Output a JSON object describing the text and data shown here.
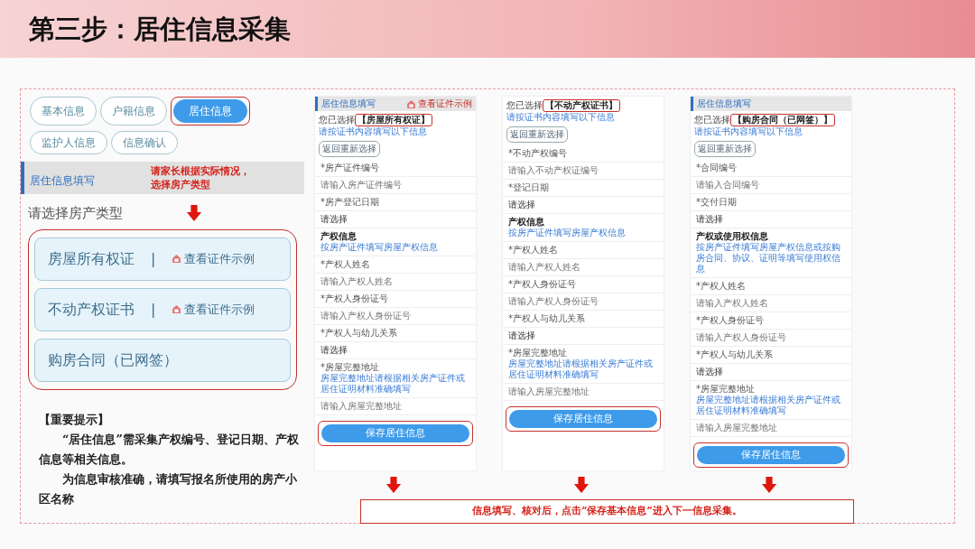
{
  "slide": {
    "title": "第三步：居住信息采集"
  },
  "left_panel": {
    "tabs": [
      {
        "label": "基本信息",
        "selected": false,
        "highlighted": false
      },
      {
        "label": "户籍信息",
        "selected": false,
        "highlighted": false
      },
      {
        "label": "居住信息",
        "selected": true,
        "highlighted": true
      },
      {
        "label": "监护人信息",
        "selected": false,
        "highlighted": false
      },
      {
        "label": "信息确认",
        "selected": false,
        "highlighted": false
      }
    ],
    "annotation": [
      "请家长根据实际情况，",
      "选择房产类型"
    ],
    "section_title": "居住信息填写",
    "prompt": "请选择房产类型",
    "options_highlighted": true,
    "options": [
      {
        "label": "房屋所有权证",
        "separator": "|",
        "link": "查看证件示例"
      },
      {
        "label": "不动产权证书",
        "separator": "|",
        "link": "查看证件示例"
      },
      {
        "label": "购房合同（已网签）"
      }
    ]
  },
  "phones": [
    {
      "header": "居住信息填写",
      "header_link": "查看证件示例",
      "selected_prefix": "您已选择",
      "selected_type": "【房屋所有权证】",
      "selected_highlighted": true,
      "hint": "请按证书内容填写以下信息",
      "back_button": "返回重新选择",
      "rows": [
        {
          "kind": "input",
          "label": "*房产证件编号",
          "placeholder": "请输入房产证件编号"
        },
        {
          "kind": "select",
          "label": "*房产登记日期",
          "value": "请选择"
        },
        {
          "kind": "section",
          "title": "产权信息",
          "note": "按房产证件填写房屋产权信息"
        },
        {
          "kind": "input",
          "label": "*产权人姓名",
          "placeholder": "请输入产权人姓名"
        },
        {
          "kind": "input",
          "label": "*产权人身份证号",
          "placeholder": "请输入产权人身份证号"
        },
        {
          "kind": "select",
          "label": "*产权人与幼儿关系",
          "value": "请选择"
        },
        {
          "kind": "input",
          "label": "*房屋完整地址",
          "note": "房屋完整地址请根据相关房产证件或居住证明材料准确填写",
          "placeholder": "请输入房屋完整地址"
        }
      ],
      "save_button": "保存居住信息",
      "save_highlighted": true
    },
    {
      "selected_prefix": "您已选择",
      "selected_type": "【不动产权证书】",
      "selected_highlighted": true,
      "hint": "请按证书内容填写以下信息",
      "back_button": "返回重新选择",
      "rows": [
        {
          "kind": "input",
          "label": "*不动产权编号",
          "placeholder": "请输入不动产权证编号"
        },
        {
          "kind": "select",
          "label": "*登记日期",
          "value": "请选择"
        },
        {
          "kind": "section",
          "title": "产权信息",
          "note": "按房产证件填写房屋产权信息"
        },
        {
          "kind": "input",
          "label": "*产权人姓名",
          "placeholder": "请输入产权人姓名"
        },
        {
          "kind": "input",
          "label": "*产权人身份证号",
          "placeholder": "请输入产权人身份证号"
        },
        {
          "kind": "select",
          "label": "*产权人与幼儿关系",
          "value": "请选择"
        },
        {
          "kind": "input",
          "label": "*房屋完整地址",
          "note": "房屋完整地址请根据相关房产证件或居住证明材料准确填写",
          "placeholder": "请输入房屋完整地址"
        }
      ],
      "save_button": "保存居住信息",
      "save_highlighted": true
    },
    {
      "header": "居住信息填写",
      "selected_prefix": "您已选择",
      "selected_type": "【购房合同（已网签）】",
      "selected_highlighted": true,
      "hint": "请按证书内容填写以下信息",
      "back_button": "返回重新选择",
      "rows": [
        {
          "kind": "input",
          "label": "*合同编号",
          "placeholder": "请输入合同编号"
        },
        {
          "kind": "select",
          "label": "*交付日期",
          "value": "请选择"
        },
        {
          "kind": "section",
          "title": "产权或使用权信息",
          "note": "按房产证件填写房屋产权信息或按购房合同、协议、证明等填写使用权信息"
        },
        {
          "kind": "input",
          "label": "*产权人姓名",
          "placeholder": "请输入产权人姓名"
        },
        {
          "kind": "input",
          "label": "*产权人身份证号",
          "placeholder": "请输入产权人身份证号"
        },
        {
          "kind": "select",
          "label": "*产权人与幼儿关系",
          "value": "请选择"
        },
        {
          "kind": "input",
          "label": "*房屋完整地址",
          "note": "房屋完整地址请根据相关房产证件或居住证明材料准确填写",
          "placeholder": "请输入房屋完整地址"
        }
      ],
      "save_button": "保存居住信息",
      "save_highlighted": true
    }
  ],
  "notes": {
    "title": "【重要提示】",
    "paragraphs": [
      "“居住信息”需采集产权编号、登记日期、产权信息等相关信息。",
      "为信息审核准确，请填写**报名所使用的房产小区名称**"
    ]
  },
  "arrow_note": "信息填写、核对后，点击“保存基本信息”进入下一信息采集。"
}
